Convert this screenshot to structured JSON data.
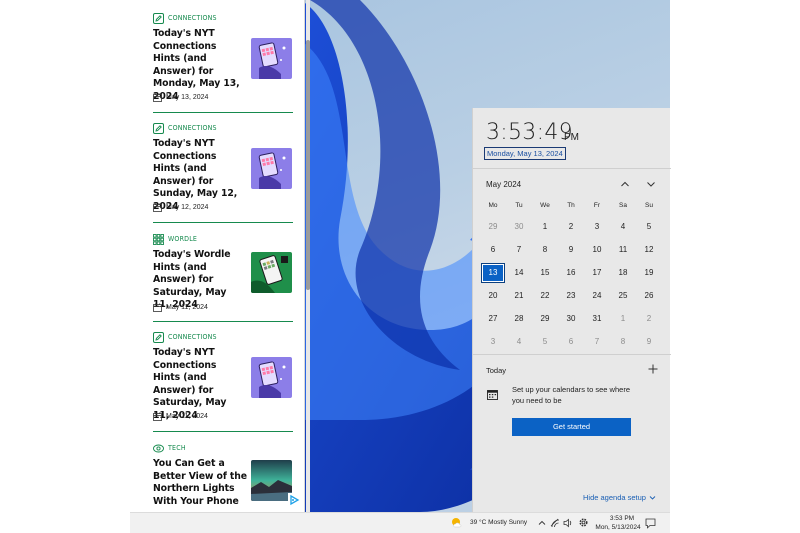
{
  "news": {
    "articles": [
      {
        "category": "CONNECTIONS",
        "category_icon": "pencil-square-icon",
        "title": "Today's NYT Connections Hints (and Answer) for Monday, May 13, 2024",
        "date": "May 13, 2024",
        "thumb": "connections-phone-thumb"
      },
      {
        "category": "CONNECTIONS",
        "category_icon": "pencil-square-icon",
        "title": "Today's NYT Connections Hints (and Answer) for Sunday, May 12, 2024",
        "date": "May 12, 2024",
        "thumb": "connections-phone-thumb"
      },
      {
        "category": "WORDLE",
        "category_icon": "grid-icon",
        "title": "Today's Wordle Hints (and Answer) for Saturday, May 11, 2024",
        "date": "May 11, 2024",
        "thumb": "wordle-phone-thumb"
      },
      {
        "category": "CONNECTIONS",
        "category_icon": "pencil-square-icon",
        "title": "Today's NYT Connections Hints (and Answer) for Saturday, May 11, 2024",
        "date": "May 11, 2024",
        "thumb": "connections-phone-thumb"
      },
      {
        "category": "TECH",
        "category_icon": "tech-icon",
        "title": "You Can Get a Better View of the Northern Lights With Your Phone",
        "date": "",
        "thumb": "aurora-thumb"
      }
    ]
  },
  "calendar": {
    "time": "3:53:49",
    "ampm": "PM",
    "full_date": "Monday, May 13, 2024",
    "month_label": "May 2024",
    "weekdays": [
      "Mo",
      "Tu",
      "We",
      "Th",
      "Fr",
      "Sa",
      "Su"
    ],
    "weeks": [
      [
        "29",
        "30",
        "1",
        "2",
        "3",
        "4",
        "5"
      ],
      [
        "6",
        "7",
        "8",
        "9",
        "10",
        "11",
        "12"
      ],
      [
        "13",
        "14",
        "15",
        "16",
        "17",
        "18",
        "19"
      ],
      [
        "20",
        "21",
        "22",
        "23",
        "24",
        "25",
        "26"
      ],
      [
        "27",
        "28",
        "29",
        "30",
        "31",
        "1",
        "2"
      ],
      [
        "3",
        "4",
        "5",
        "6",
        "7",
        "8",
        "9"
      ]
    ],
    "selected_day": "13",
    "agenda_label": "Today",
    "agenda_message": "Set up your calendars to see where you need to be",
    "get_started_label": "Get started",
    "hide_agenda_label": "Hide agenda setup"
  },
  "taskbar": {
    "weather": "39 °C  Mostly Sunny",
    "time": "3:53 PM",
    "date": "Mon, 5/13/2024"
  },
  "colors": {
    "accent_green": "#168a4e",
    "accent_blue": "#0b62c5"
  }
}
